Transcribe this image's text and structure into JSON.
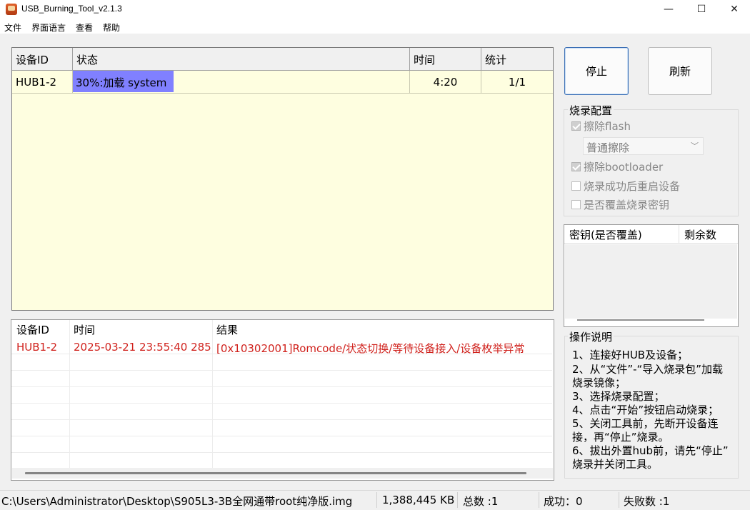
{
  "window": {
    "title": "USB_Burning_Tool_v2.1.3",
    "controls": {
      "minimize": "—",
      "maximize": "☐",
      "close": "✕"
    }
  },
  "menu": [
    "文件",
    "界面语言",
    "查看",
    "帮助"
  ],
  "device_table": {
    "columns": [
      "设备ID",
      "状态",
      "时间",
      "统计"
    ],
    "rows": [
      {
        "device_id": "HUB1-2",
        "status": "30%:加载 system",
        "progress": 0.3,
        "time": "4:20",
        "count": "1/1"
      }
    ],
    "progress_color": "#8080ff",
    "background": "#fefee0"
  },
  "buttons": {
    "stop": "停止",
    "refresh": "刷新"
  },
  "burn_config": {
    "title": "烧录配置",
    "erase_flash": {
      "label": "擦除flash",
      "checked": true,
      "enabled": false
    },
    "erase_mode": {
      "value": "普通擦除"
    },
    "erase_bootloader": {
      "label": "擦除bootloader",
      "checked": true,
      "enabled": false
    },
    "reboot_after": {
      "label": "烧录成功后重启设备",
      "checked": false,
      "enabled": false
    },
    "overwrite_keys": {
      "label": "是否覆盖烧录密钥",
      "checked": false,
      "enabled": false
    }
  },
  "keys_table": {
    "columns": [
      "密钥(是否覆盖)",
      "剩余数"
    ]
  },
  "log_table": {
    "columns": [
      "设备ID",
      "时间",
      "结果"
    ],
    "rows": [
      {
        "device_id": "HUB1-2",
        "time": "2025-03-21 23:55:40 285",
        "result": "[0x10302001]Romcode/状态切换/等待设备接入/设备枚举异常"
      }
    ],
    "error_color": "#d0211c"
  },
  "instructions": {
    "title": "操作说明",
    "lines": [
      "1、连接好HUB及设备；",
      "2、从“文件”-“导入烧录包”加载",
      "烧录镜像；",
      "3、选择烧录配置；",
      "4、点击“开始”按钮启动烧录；",
      "5、关闭工具前，先断开设备连",
      "接，再“停止”烧录。",
      "6、拔出外置hub前，请先“停止”",
      "烧录并关闭工具。"
    ]
  },
  "status_bar": {
    "path": "C:\\Users\\Administrator\\Desktop\\S905L3-3B全网通带root纯净版.img",
    "size": "1,388,445 KB",
    "total": "总数 :1",
    "success": "成功：0",
    "failed": "失败数 :1"
  }
}
